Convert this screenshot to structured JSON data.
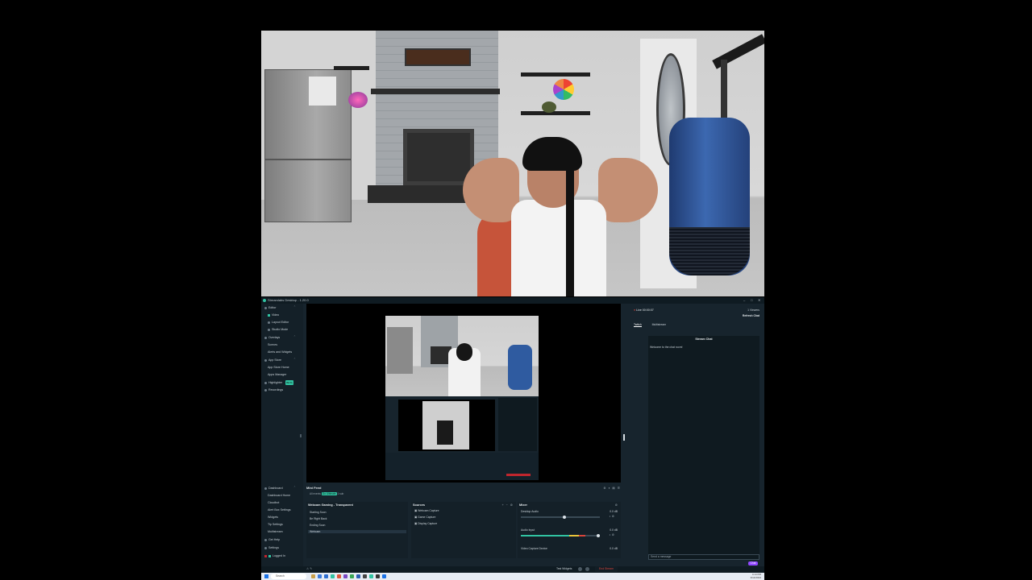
{
  "window": {
    "title": "Streamlabs Desktop - 1.20.0",
    "minimize": "–",
    "maximize": "□",
    "close": "✕"
  },
  "sidebar": {
    "items": [
      {
        "label": "Editor"
      },
      {
        "label": "Video"
      },
      {
        "label": "Layout Editor"
      },
      {
        "label": "Studio Mode"
      },
      {
        "label": "Overlays"
      },
      {
        "label": "Scenes"
      },
      {
        "label": "Alerts and Widgets"
      },
      {
        "label": "App Store"
      },
      {
        "label": "App Store Home"
      },
      {
        "label": "Apps Manager"
      },
      {
        "label": "Highlighter",
        "badge": "BETA"
      },
      {
        "label": "Recordings"
      }
    ],
    "bottom_items": [
      {
        "label": "Dashboard"
      },
      {
        "label": "Dashboard Home"
      },
      {
        "label": "Cloudbot"
      },
      {
        "label": "Alert Box Settings"
      },
      {
        "label": "Widgets"
      },
      {
        "label": "Tip Settings"
      },
      {
        "label": "Multistream"
      },
      {
        "label": "Get Help"
      },
      {
        "label": "Settings"
      },
      {
        "label": "Logged In"
      }
    ]
  },
  "feed": {
    "label": "Mini Feed",
    "subtitle": "All events",
    "badge": "Go Ultimate",
    "counter": "1 sub"
  },
  "scenes": {
    "title": "Webcam Gaming - Transparent",
    "items": [
      "Starting Soon",
      "Be Right Back",
      "Ending Soon",
      "Webcam"
    ],
    "selected_index": 3
  },
  "sources": {
    "title": "Sources",
    "items": [
      "Webcam Capture",
      "Game Capture",
      "Display Capture"
    ]
  },
  "mixer": {
    "title": "Mixer",
    "channels": [
      {
        "name": "Desktop Audio",
        "db": "0.0 dB",
        "level": 0.0,
        "volume": 0.55
      },
      {
        "name": "Audio Input",
        "db": "0.0 dB",
        "level": 0.82,
        "volume": 0.98
      },
      {
        "name": "Video Capture Device",
        "db": "0.0 dB",
        "level": 0.0,
        "volume": 0.98
      }
    ]
  },
  "chat": {
    "user": "Live 00:00:07",
    "viewers": "1 Viewers",
    "refresh": "Refresh Chat",
    "tabs": [
      "Twitch",
      "Multistream"
    ],
    "box_title": "Stream Chat",
    "message": "Welcome to the chat room!",
    "placeholder": "Send a message",
    "send": "Chat"
  },
  "statusbar": {
    "test_widgets": "Test Widgets",
    "go_live": "End Stream"
  },
  "taskbar": {
    "search_placeholder": "Search",
    "time": "4:14 PM",
    "date": "3/14/2024"
  },
  "colors": {
    "accent": "#31c3a2",
    "app_bg": "#17242d",
    "sidebar_bg": "#142028",
    "live_red": "#d9443a",
    "twitch_purple": "#9146ff"
  }
}
